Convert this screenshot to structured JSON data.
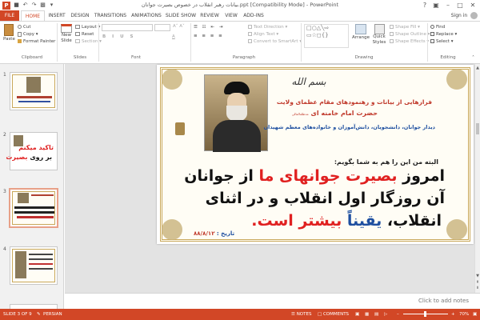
{
  "titlebar": {
    "title": "بیانات رهبر انقلاب در خصوص بصیرت جوانان.ppt [Compatibility Mode] - PowerPoint",
    "help": "?",
    "signin": "Sign in"
  },
  "tabs": {
    "file": "FILE",
    "home": "HOME",
    "insert": "INSERT",
    "design": "DESIGN",
    "transitions": "TRANSITIONS",
    "animations": "ANIMATIONS",
    "slideshow": "SLIDE SHOW",
    "review": "REVIEW",
    "view": "VIEW",
    "addins": "ADD-INS"
  },
  "ribbon": {
    "clipboard": {
      "paste": "Paste",
      "cut": "Cut",
      "copy": "Copy",
      "format_painter": "Format Painter",
      "label": "Clipboard"
    },
    "slides": {
      "new_slide_l1": "New",
      "new_slide_l2": "Slide",
      "layout": "Layout",
      "reset": "Reset",
      "section": "Section",
      "label": "Slides"
    },
    "font": {
      "label": "Font"
    },
    "paragraph": {
      "text_direction": "Text Direction",
      "align_text": "Align Text",
      "convert_smartart": "Convert to SmartArt",
      "label": "Paragraph"
    },
    "drawing": {
      "arrange": "Arrange",
      "quick_l1": "Quick",
      "quick_l2": "Styles",
      "shape_fill": "Shape Fill",
      "shape_outline": "Shape Outline",
      "shape_effects": "Shape Effects",
      "label": "Drawing"
    },
    "editing": {
      "find": "Find",
      "replace": "Replace",
      "select": "Select",
      "label": "Editing"
    }
  },
  "thumbnails": [
    {
      "num": "1"
    },
    {
      "num": "2",
      "line1": "تاکید میکنم",
      "line2": "بر روی",
      "line2b": "بصیرت"
    },
    {
      "num": "3"
    },
    {
      "num": "4"
    }
  ],
  "slide": {
    "logo": "بسم الله",
    "intro": "فرازهایی از بیانات و رهنمودهای مقام عظمای ولایت",
    "leader": "حضرت امام خامنه ای",
    "leader_suffix": "مدظله‌العالی",
    "event": "دیدار جوانان، دانشجویان، دانش‌آموزان و خانواده‌های معظم شهیدان",
    "lead_in": "البته من این را هم به شما بگویم:",
    "q1a": "امروز ",
    "q1b": "بصیرت جوانهای ما",
    "q1c": " از جوانان",
    "q2": "آن روزگار اول انقلاب و در اثنای",
    "q3a": "انقلاب، ",
    "q3b": "یقیناً",
    "q3c": " بیشتر است.",
    "date_label": "تاریخ :",
    "date_value": "۸۸/۸/۱۲"
  },
  "notes": {
    "placeholder": "Click to add notes"
  },
  "status": {
    "slide": "SLIDE 3 OF 9",
    "language": "PERSIAN",
    "notes": "NOTES",
    "comments": "COMMENTS",
    "zoom": "70%"
  }
}
